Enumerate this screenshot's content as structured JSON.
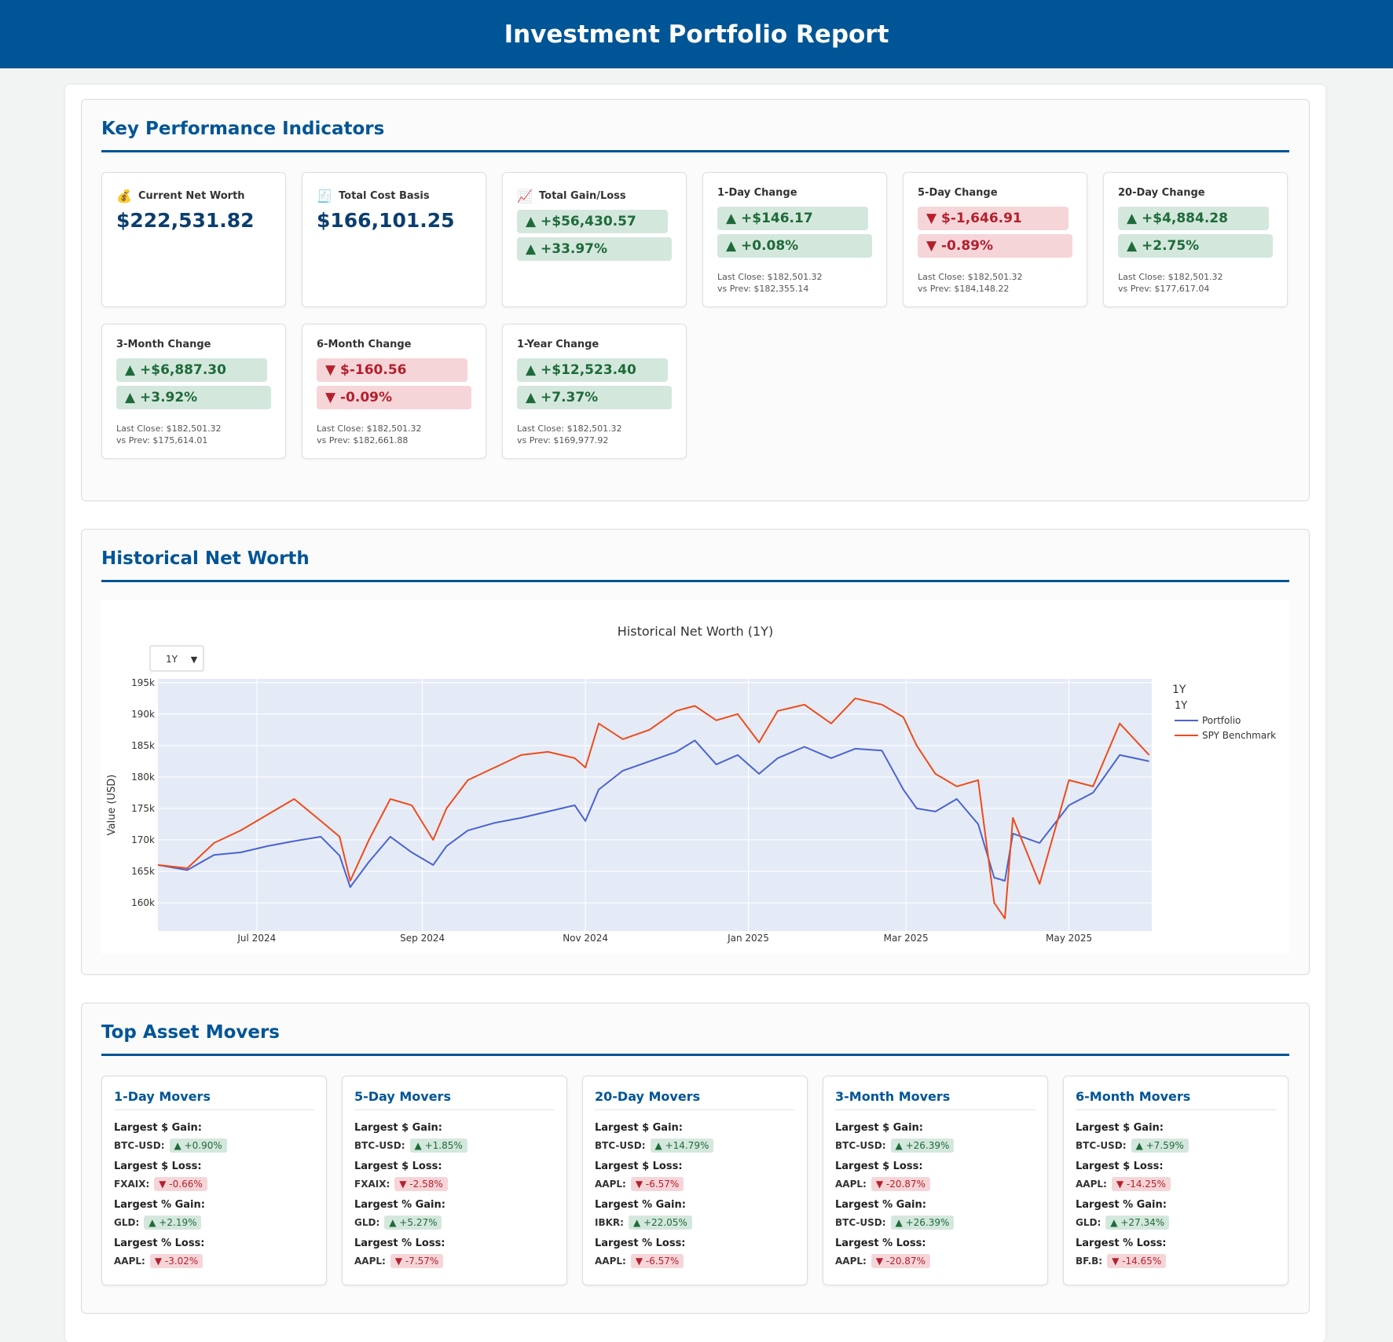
{
  "header": {
    "title": "Investment Portfolio Report"
  },
  "kpi": {
    "heading": "Key Performance Indicators",
    "cards": [
      {
        "title": "Current Net Worth",
        "icon": "money-bag-icon",
        "value": "$222,531.82"
      },
      {
        "title": "Total Cost Basis",
        "icon": "receipt-icon",
        "value": "$166,101.25"
      },
      {
        "title": "Total Gain/Loss",
        "icon": "chart-up-icon",
        "amount": "▲ +$56,430.57",
        "percent": "▲ +33.97%",
        "direction": "up"
      },
      {
        "title": "1-Day Change",
        "amount": "▲ +$146.17",
        "percent": "▲ +0.08%",
        "direction": "up",
        "last_close": "Last Close: $182,501.32",
        "vs_prev": "vs Prev: $182,355.14"
      },
      {
        "title": "5-Day Change",
        "amount": "▼ $-1,646.91",
        "percent": "▼ -0.89%",
        "direction": "down",
        "last_close": "Last Close: $182,501.32",
        "vs_prev": "vs Prev: $184,148.22"
      },
      {
        "title": "20-Day Change",
        "amount": "▲ +$4,884.28",
        "percent": "▲ +2.75%",
        "direction": "up",
        "last_close": "Last Close: $182,501.32",
        "vs_prev": "vs Prev: $177,617.04"
      },
      {
        "title": "3-Month Change",
        "amount": "▲ +$6,887.30",
        "percent": "▲ +3.92%",
        "direction": "up",
        "last_close": "Last Close: $182,501.32",
        "vs_prev": "vs Prev: $175,614.01"
      },
      {
        "title": "6-Month Change",
        "amount": "▼ $-160.56",
        "percent": "▼ -0.09%",
        "direction": "down",
        "last_close": "Last Close: $182,501.32",
        "vs_prev": "vs Prev: $182,661.88"
      },
      {
        "title": "1-Year Change",
        "amount": "▲ +$12,523.40",
        "percent": "▲ +7.37%",
        "direction": "up",
        "last_close": "Last Close: $182,501.32",
        "vs_prev": "vs Prev: $169,977.92"
      }
    ]
  },
  "history": {
    "heading": "Historical Net Worth",
    "range_select": {
      "value": "1Y",
      "arrow": "▼"
    },
    "legend_title_1": "1Y",
    "legend_title_2": "1Y"
  },
  "chart_data": {
    "type": "line",
    "title": "Historical Net Worth (1Y)",
    "xlabel": "",
    "ylabel": "Value (USD)",
    "x_start": "2024-05-25",
    "x_end": "2025-06-01",
    "x_ticks": [
      "Jul 2024",
      "Sep 2024",
      "Nov 2024",
      "Jan 2025",
      "Mar 2025",
      "May 2025"
    ],
    "x_tick_dates": [
      "2024-07-01",
      "2024-09-01",
      "2024-11-01",
      "2025-01-01",
      "2025-03-01",
      "2025-05-01"
    ],
    "y_ticks": [
      "160k",
      "165k",
      "170k",
      "175k",
      "180k",
      "185k",
      "190k",
      "195k"
    ],
    "y_tick_values": [
      160000,
      165000,
      170000,
      175000,
      180000,
      185000,
      190000,
      195000
    ],
    "ylim": [
      155500,
      195600
    ],
    "grid": true,
    "legend_position": "right",
    "series": [
      {
        "name": "Portfolio",
        "color": "#4a63d0",
        "x": [
          "2024-05-25",
          "2024-06-05",
          "2024-06-15",
          "2024-06-25",
          "2024-07-05",
          "2024-07-15",
          "2024-07-25",
          "2024-08-01",
          "2024-08-05",
          "2024-08-12",
          "2024-08-20",
          "2024-08-28",
          "2024-09-05",
          "2024-09-10",
          "2024-09-18",
          "2024-09-28",
          "2024-10-08",
          "2024-10-18",
          "2024-10-28",
          "2024-11-01",
          "2024-11-06",
          "2024-11-15",
          "2024-11-25",
          "2024-12-05",
          "2024-12-12",
          "2024-12-20",
          "2024-12-28",
          "2025-01-05",
          "2025-01-12",
          "2025-01-22",
          "2025-02-01",
          "2025-02-10",
          "2025-02-20",
          "2025-02-28",
          "2025-03-05",
          "2025-03-12",
          "2025-03-20",
          "2025-03-28",
          "2025-04-03",
          "2025-04-07",
          "2025-04-10",
          "2025-04-20",
          "2025-05-01",
          "2025-05-10",
          "2025-05-20",
          "2025-05-31"
        ],
        "values": [
          166000,
          165200,
          167600,
          168000,
          169000,
          169800,
          170500,
          167500,
          162500,
          166500,
          170500,
          168000,
          166000,
          169000,
          171500,
          172700,
          173500,
          174500,
          175500,
          173000,
          178000,
          181000,
          182500,
          184000,
          185800,
          182000,
          183500,
          180500,
          183000,
          184800,
          183000,
          184500,
          184200,
          178000,
          175000,
          174500,
          176500,
          172500,
          164000,
          163500,
          171000,
          169500,
          175500,
          177500,
          183500,
          182500
        ]
      },
      {
        "name": "SPY Benchmark",
        "color": "#ee4b1a",
        "x": [
          "2024-05-25",
          "2024-06-05",
          "2024-06-15",
          "2024-06-25",
          "2024-07-05",
          "2024-07-15",
          "2024-07-25",
          "2024-08-01",
          "2024-08-05",
          "2024-08-12",
          "2024-08-20",
          "2024-08-28",
          "2024-09-05",
          "2024-09-10",
          "2024-09-18",
          "2024-09-28",
          "2024-10-08",
          "2024-10-18",
          "2024-10-28",
          "2024-11-01",
          "2024-11-06",
          "2024-11-15",
          "2024-11-25",
          "2024-12-05",
          "2024-12-12",
          "2024-12-20",
          "2024-12-28",
          "2025-01-05",
          "2025-01-12",
          "2025-01-22",
          "2025-02-01",
          "2025-02-10",
          "2025-02-20",
          "2025-02-28",
          "2025-03-05",
          "2025-03-12",
          "2025-03-20",
          "2025-03-28",
          "2025-04-03",
          "2025-04-07",
          "2025-04-10",
          "2025-04-20",
          "2025-05-01",
          "2025-05-10",
          "2025-05-20",
          "2025-05-31"
        ],
        "values": [
          166000,
          165500,
          169500,
          171500,
          174000,
          176500,
          173000,
          170500,
          163500,
          170000,
          176500,
          175500,
          170000,
          175000,
          179500,
          181500,
          183500,
          184000,
          183000,
          181500,
          188500,
          186000,
          187500,
          190500,
          191300,
          189000,
          190000,
          185500,
          190500,
          191500,
          188500,
          192500,
          191500,
          189500,
          185000,
          180500,
          178500,
          179500,
          160000,
          157500,
          173500,
          163000,
          179500,
          178500,
          188500,
          183500
        ]
      }
    ]
  },
  "movers": {
    "heading": "Top Asset Movers",
    "labels": {
      "gain_d": "Largest $ Gain:",
      "loss_d": "Largest $ Loss:",
      "gain_p": "Largest % Gain:",
      "loss_p": "Largest % Loss:"
    },
    "cards": [
      {
        "title": "1-Day Movers",
        "gain_d": {
          "sym": "BTC-USD:",
          "val": "▲ +0.90%"
        },
        "loss_d": {
          "sym": "FXAIX:",
          "val": "▼ -0.66%"
        },
        "gain_p": {
          "sym": "GLD:",
          "val": "▲ +2.19%"
        },
        "loss_p": {
          "sym": "AAPL:",
          "val": "▼ -3.02%"
        }
      },
      {
        "title": "5-Day Movers",
        "gain_d": {
          "sym": "BTC-USD:",
          "val": "▲ +1.85%"
        },
        "loss_d": {
          "sym": "FXAIX:",
          "val": "▼ -2.58%"
        },
        "gain_p": {
          "sym": "GLD:",
          "val": "▲ +5.27%"
        },
        "loss_p": {
          "sym": "AAPL:",
          "val": "▼ -7.57%"
        }
      },
      {
        "title": "20-Day Movers",
        "gain_d": {
          "sym": "BTC-USD:",
          "val": "▲ +14.79%"
        },
        "loss_d": {
          "sym": "AAPL:",
          "val": "▼ -6.57%"
        },
        "gain_p": {
          "sym": "IBKR:",
          "val": "▲ +22.05%"
        },
        "loss_p": {
          "sym": "AAPL:",
          "val": "▼ -6.57%"
        }
      },
      {
        "title": "3-Month Movers",
        "gain_d": {
          "sym": "BTC-USD:",
          "val": "▲ +26.39%"
        },
        "loss_d": {
          "sym": "AAPL:",
          "val": "▼ -20.87%"
        },
        "gain_p": {
          "sym": "BTC-USD:",
          "val": "▲ +26.39%"
        },
        "loss_p": {
          "sym": "AAPL:",
          "val": "▼ -20.87%"
        }
      },
      {
        "title": "6-Month Movers",
        "gain_d": {
          "sym": "BTC-USD:",
          "val": "▲ +7.59%"
        },
        "loss_d": {
          "sym": "AAPL:",
          "val": "▼ -14.25%"
        },
        "gain_p": {
          "sym": "GLD:",
          "val": "▲ +27.34%"
        },
        "loss_p": {
          "sym": "BF.B:",
          "val": "▼ -14.65%"
        }
      }
    ]
  }
}
